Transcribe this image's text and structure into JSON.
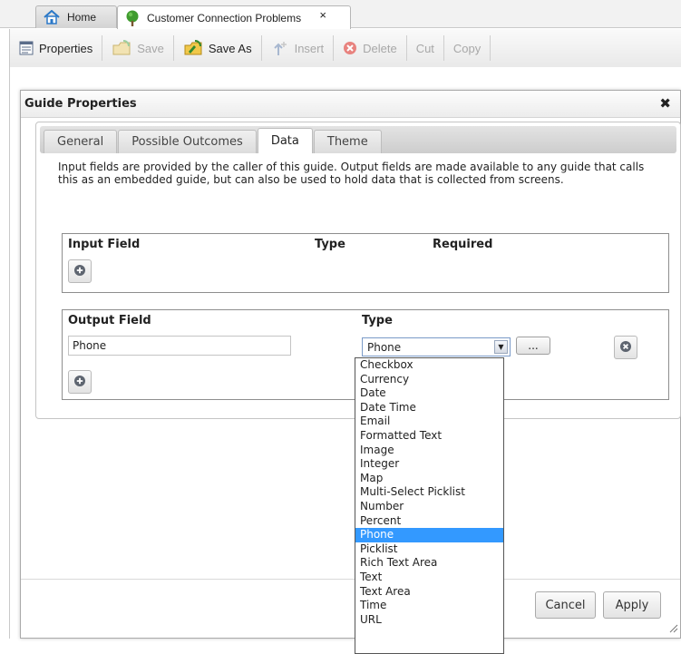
{
  "tabs": {
    "home_label": "Home",
    "active_label": "Customer Connection Problems",
    "close_glyph": "×"
  },
  "toolbar": {
    "properties": "Properties",
    "save": "Save",
    "save_as": "Save As",
    "insert": "Insert",
    "delete": "Delete",
    "cut": "Cut",
    "copy": "Copy"
  },
  "dialog": {
    "title": "Guide Properties",
    "close_glyph": "✖",
    "tabs": [
      "General",
      "Possible Outcomes",
      "Data",
      "Theme"
    ],
    "selected_tab": "Data",
    "intro": "Input fields are provided by the caller of this guide. Output fields are made available to any guide that calls this as an embedded guide, but can also be used to hold data that is collected from screens.",
    "input_section": {
      "col_field": "Input Field",
      "col_type": "Type",
      "col_required": "Required"
    },
    "output_section": {
      "col_field": "Output Field",
      "col_type": "Type",
      "field_value": "Phone",
      "type_value": "Phone",
      "more_label": "..."
    },
    "buttons": {
      "cancel": "Cancel",
      "apply": "Apply"
    }
  },
  "type_options": [
    "Checkbox",
    "Currency",
    "Date",
    "Date Time",
    "Email",
    "Formatted Text",
    "Image",
    "Integer",
    "Map",
    "Multi-Select Picklist",
    "Number",
    "Percent",
    "Phone",
    "Picklist",
    "Rich Text Area",
    "Text",
    "Text Area",
    "Time",
    "URL"
  ],
  "selected_option": "Phone",
  "colors": {
    "selection": "#3399ff",
    "delete_icon": "#e0403a",
    "home_icon": "#2a78c8",
    "tree_icon": "#3f9b2e"
  }
}
